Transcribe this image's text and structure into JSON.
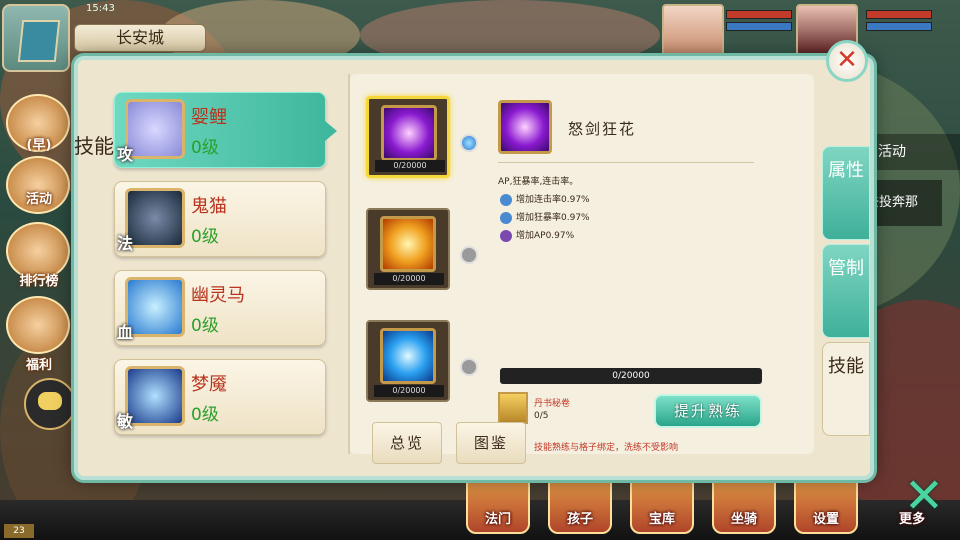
{
  "hud": {
    "location": "长安城",
    "status_text": "15:43",
    "right_activity": "活动",
    "right_quest": "去投奔那"
  },
  "left_menu": [
    {
      "label": "(早)"
    },
    {
      "label": "活动"
    },
    {
      "label": "排行榜"
    },
    {
      "label": "福利"
    }
  ],
  "bottom_menu": [
    {
      "label": "法门"
    },
    {
      "label": "孩子"
    },
    {
      "label": "宝库"
    },
    {
      "label": "坐骑"
    },
    {
      "label": "设置"
    },
    {
      "label": "更多"
    }
  ],
  "level_tag": "23",
  "dialog": {
    "section_label": "技能",
    "close_symbol": "✕",
    "pets": [
      {
        "name": "婴鲤",
        "level": "0级",
        "type": "攻",
        "color": "#8a8ad8",
        "selected": true
      },
      {
        "name": "鬼猫",
        "level": "0级",
        "type": "法",
        "color": "#3a4a6a",
        "selected": false
      },
      {
        "name": "幽灵马",
        "level": "0级",
        "type": "血",
        "color": "#5ab8e0",
        "selected": false
      },
      {
        "name": "梦魇",
        "level": "0级",
        "type": "敏",
        "color": "#3a7ad0",
        "selected": false
      }
    ],
    "skills": [
      {
        "xp": "0/20000",
        "icon_color": "#b03ae0",
        "selected": true
      },
      {
        "xp": "0/20000",
        "icon_color": "#f0a020",
        "selected": false
      },
      {
        "xp": "0/20000",
        "icon_color": "#2aa0f0",
        "selected": false
      }
    ],
    "detail": {
      "name": "怒剑狂花",
      "description": "AP,狂暴率,连击率。",
      "effects": [
        {
          "text": "增加连击率0.97%",
          "icon": "swirl-icon"
        },
        {
          "text": "增加狂暴率0.97%",
          "icon": "swirl-icon"
        },
        {
          "text": "增加AP0.97%",
          "icon": "sword-icon"
        }
      ],
      "xp_bar": "0/20000",
      "xp_fraction": 0,
      "book_name": "丹书秘卷",
      "book_count": "0/5",
      "upgrade_label": "提升熟练",
      "note": "技能熟练与格子绑定，洗练不受影响"
    },
    "bottom_tabs": [
      {
        "label": "总览"
      },
      {
        "label": "图鉴"
      }
    ],
    "right_tabs": [
      {
        "label": "属性"
      },
      {
        "label": "管制"
      },
      {
        "label": "技能"
      }
    ]
  }
}
